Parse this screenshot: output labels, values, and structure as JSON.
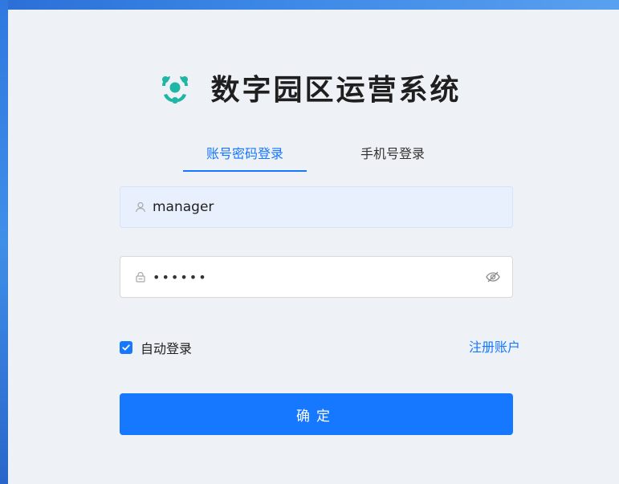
{
  "app": {
    "title": "数字园区运营系统"
  },
  "tabs": [
    {
      "label": "账号密码登录",
      "active": true
    },
    {
      "label": "手机号登录",
      "active": false
    }
  ],
  "username": {
    "value": "manager",
    "icon": "user-icon"
  },
  "password": {
    "masked_value": "••••••",
    "icon": "lock-icon",
    "toggle_icon": "eye-off-icon"
  },
  "remember": {
    "label": "自动登录",
    "checked": true
  },
  "register_link": {
    "label": "注册账户"
  },
  "submit": {
    "label": "确定"
  },
  "colors": {
    "accent": "#1677ff",
    "logo": "#1fb6a6",
    "background": "#eef1f5"
  }
}
